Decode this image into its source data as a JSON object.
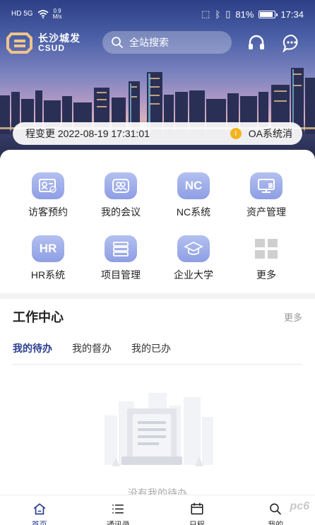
{
  "status_bar": {
    "network": "HD 5G",
    "speed_value": "0.9",
    "speed_unit": "M/s",
    "battery": "81%",
    "time": "17:34"
  },
  "header": {
    "logo_cn": "长沙城发",
    "logo_en": "CSUD",
    "search_placeholder": "全站搜索",
    "icons": [
      "headset-icon",
      "message-icon"
    ]
  },
  "notice": {
    "text": "程变更  2022-08-19 17:31:01",
    "badge_text": "OA系统消"
  },
  "quick_grid": {
    "items": [
      {
        "label": "访客预约",
        "icon": "visitor-card-icon"
      },
      {
        "label": "我的会议",
        "icon": "meeting-icon"
      },
      {
        "label": "NC系统",
        "icon": "nc-icon",
        "icon_text": "NC"
      },
      {
        "label": "资产管理",
        "icon": "monitor-icon"
      },
      {
        "label": "HR系统",
        "icon": "hr-icon",
        "icon_text": "HR"
      },
      {
        "label": "项目管理",
        "icon": "list-icon"
      },
      {
        "label": "企业大学",
        "icon": "graduation-cap-icon"
      },
      {
        "label": "更多",
        "icon": "grid-more-icon"
      }
    ]
  },
  "work_center": {
    "title": "工作中心",
    "more": "更多",
    "tabs": [
      {
        "label": "我的待办",
        "active": true
      },
      {
        "label": "我的督办",
        "active": false
      },
      {
        "label": "我的已办",
        "active": false
      }
    ],
    "empty_text": "没有我的待办"
  },
  "bottom_nav": {
    "items": [
      {
        "label": "首页",
        "icon": "home-icon",
        "active": true
      },
      {
        "label": "通讯录",
        "icon": "contacts-icon",
        "active": false
      },
      {
        "label": "日程",
        "icon": "calendar-icon",
        "active": false
      },
      {
        "label": "我的",
        "icon": "search-user-icon",
        "active": false
      }
    ]
  },
  "watermark": "pc6",
  "colors": {
    "accent": "#2c3f8f",
    "icon_bg": "#9aa8e8",
    "notice_dot": "#f2b51d"
  }
}
